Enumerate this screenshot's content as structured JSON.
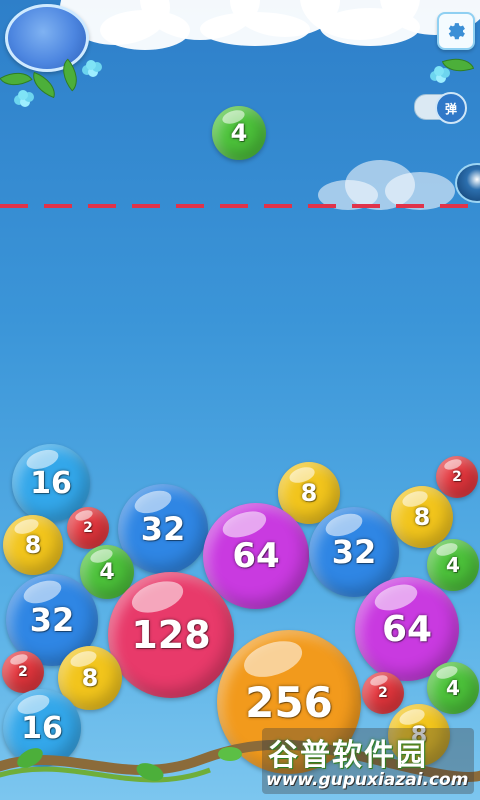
{
  "game": {
    "falling_ball": {
      "value": "4",
      "color": "#4cc23a"
    },
    "balls": [
      {
        "value": "16",
        "color": "#33a7ea"
      },
      {
        "value": "2",
        "color": "#e5363d"
      },
      {
        "value": "8",
        "color": "#f2c51c"
      },
      {
        "value": "2",
        "color": "#e5363d"
      },
      {
        "value": "32",
        "color": "#2f86e4"
      },
      {
        "value": "8",
        "color": "#f2c51c"
      },
      {
        "value": "8",
        "color": "#f2c51c"
      },
      {
        "value": "4",
        "color": "#4cc23a"
      },
      {
        "value": "64",
        "color": "#c93ae0"
      },
      {
        "value": "32",
        "color": "#2f86e4"
      },
      {
        "value": "4",
        "color": "#4cc23a"
      },
      {
        "value": "32",
        "color": "#2f86e4"
      },
      {
        "value": "128",
        "color": "#e83a6a"
      },
      {
        "value": "64",
        "color": "#c93ae0"
      },
      {
        "value": "2",
        "color": "#e5363d"
      },
      {
        "value": "8",
        "color": "#f2c51c"
      },
      {
        "value": "256",
        "color": "#f29a1c"
      },
      {
        "value": "2",
        "color": "#e5363d"
      },
      {
        "value": "4",
        "color": "#4cc23a"
      },
      {
        "value": "16",
        "color": "#33a7ea"
      },
      {
        "value": "8",
        "color": "#f2c51c"
      }
    ],
    "dead_line_color": "#e0334a"
  },
  "hud": {
    "settings_icon": "gear-icon",
    "toggle_label": "弹"
  },
  "watermark": {
    "title": "谷普软件园",
    "url": "www.gupuxiazai.com"
  }
}
